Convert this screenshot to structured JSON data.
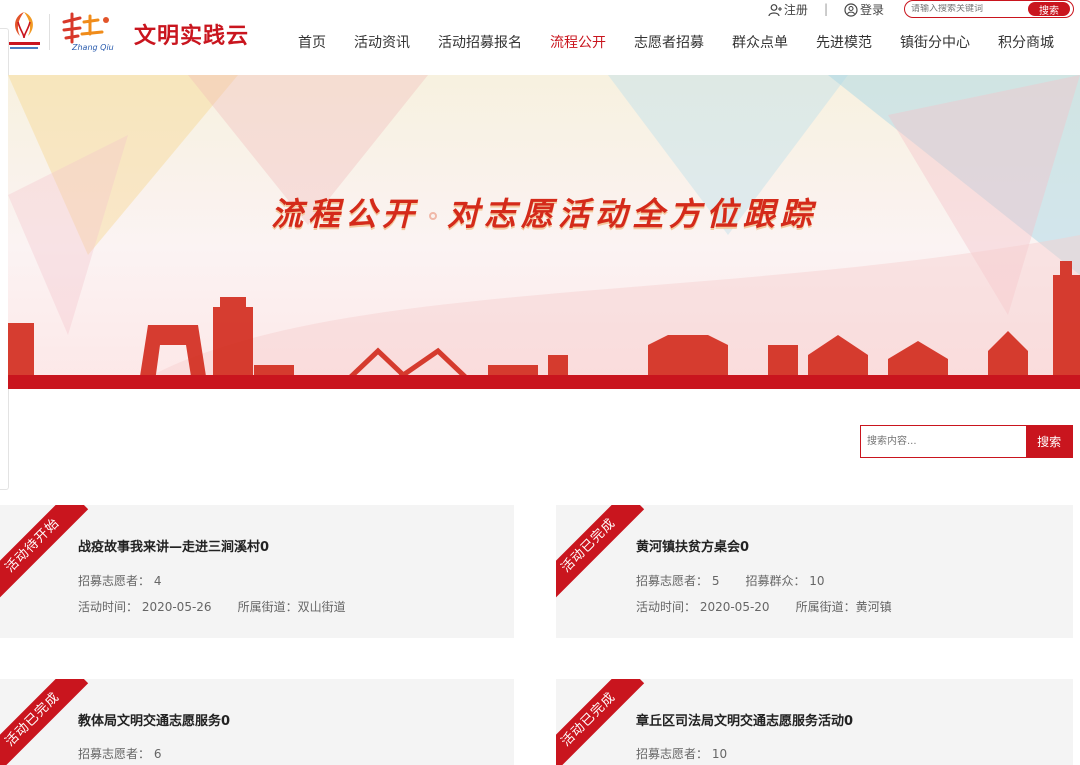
{
  "header": {
    "brand_title": "文明实践云",
    "zq_logo_text": "Zhang Qiu",
    "top_links": {
      "register": "注册",
      "login": "登录",
      "separator": "|"
    },
    "search": {
      "placeholder": "请输入搜索关键词",
      "button": "搜索"
    },
    "nav": [
      {
        "label": "首页",
        "active": false
      },
      {
        "label": "活动资讯",
        "active": false
      },
      {
        "label": "活动招募报名",
        "active": false
      },
      {
        "label": "流程公开",
        "active": true
      },
      {
        "label": "志愿者招募",
        "active": false
      },
      {
        "label": "群众点单",
        "active": false
      },
      {
        "label": "先进模范",
        "active": false
      },
      {
        "label": "镇街分中心",
        "active": false
      },
      {
        "label": "积分商城",
        "active": false
      }
    ]
  },
  "banner": {
    "title_part1": "流程公开",
    "title_part2": "对志愿活动全方位跟踪"
  },
  "main_search": {
    "placeholder": "搜索内容...",
    "button": "搜索"
  },
  "cards": [
    {
      "status": "活动待开始",
      "title": "战疫故事我来讲—走进三涧溪村0",
      "volunteers": "招募志愿者：  4",
      "masses": "",
      "time": "活动时间：  2020-05-26",
      "street": "所属街道：双山街道"
    },
    {
      "status": "活动已完成",
      "title": "黄河镇扶贫方桌会0",
      "volunteers": "招募志愿者：  5",
      "masses": "招募群众：  10",
      "time": "活动时间：  2020-05-20",
      "street": "所属街道：黄河镇"
    },
    {
      "status": "活动已完成",
      "title": "教体局文明交通志愿服务0",
      "volunteers": "招募志愿者：  6",
      "masses": "",
      "time": "",
      "street": ""
    },
    {
      "status": "活动已完成",
      "title": "章丘区司法局文明交通志愿服务活动0",
      "volunteers": "招募志愿者：  10",
      "masses": "",
      "time": "",
      "street": ""
    }
  ],
  "colors": {
    "accent": "#c9151e",
    "card_bg": "#f4f4f4"
  },
  "icons": {
    "register": "user-add-icon",
    "login": "user-circle-icon"
  }
}
